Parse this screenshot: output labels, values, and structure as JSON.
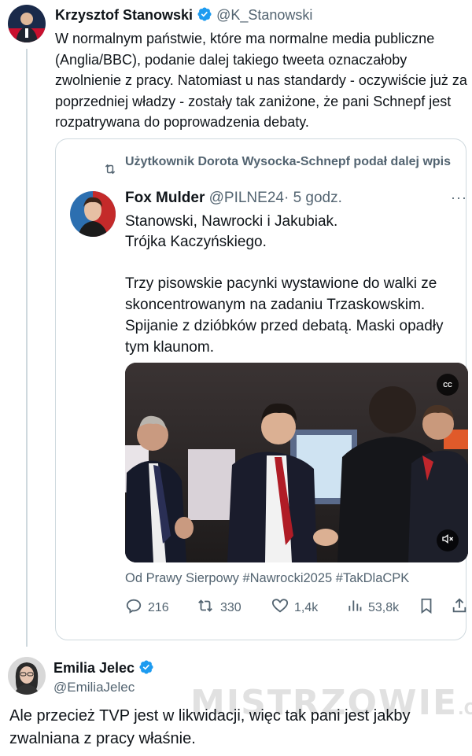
{
  "tweet1": {
    "author_name": "Krzysztof Stanowski",
    "author_handle": "@K_Stanowski",
    "text": "W normalnym państwie, które ma normalne media publiczne (Anglia/BBC), podanie dalej takiego tweeta oznaczałoby zwolnienie z pracy. Natomiast u nas standardy - oczywiście już za poprzedniej władzy - zostały tak zaniżone, że pani Schnepf jest rozpatrywana do poprowadzenia debaty.",
    "verified": true
  },
  "quote": {
    "repost_label": "Użytkownik Dorota Wysocka-Schnepf podał dalej wpis",
    "author_name": "Fox Mulder",
    "author_handle": "@PILNE24",
    "time": "· 5 godz.",
    "more": "···",
    "text_line1": "Stanowski, Nawrocki i Jakubiak.",
    "text_line2": "Trójka Kaczyńskiego.",
    "text_para2": "Trzy pisowskie pacynki wystawione do walki ze skoncentrowanym na zadaniu Trzaskowskim. Spijanie z dzióbków przed debatą. Maski opadły tym klaunom.",
    "cc_label": "CC",
    "source_line": "Od Prawy Sierpowy #Nawrocki2025 #TakDlaCPK",
    "actions": {
      "replies": "216",
      "reposts": "330",
      "likes": "1,4k",
      "views": "53,8k"
    }
  },
  "tweet2": {
    "author_name": "Emilia Jelec",
    "author_handle": "@EmiliaJelec",
    "text": "Ale przecież TVP jest w likwidacji, więc tak pani jest jakby zwalniana z pracy właśnie.",
    "verified": true
  },
  "watermark": {
    "main": "MISTRZOWIE",
    "suffix": ".ORG"
  },
  "colors": {
    "text": "#0f1419",
    "secondary": "#536471",
    "verified_blue": "#1d9bf0",
    "border": "#cfd9de"
  }
}
